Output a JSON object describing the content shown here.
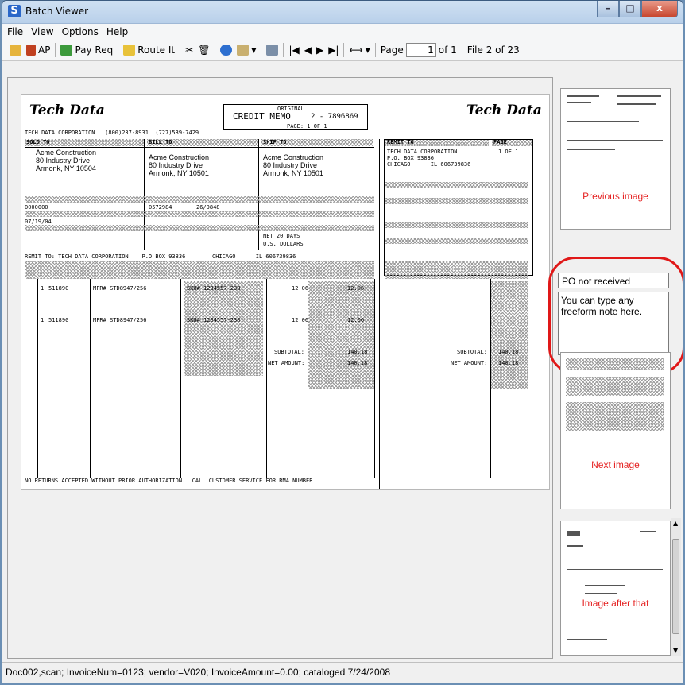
{
  "window": {
    "title": "Batch Viewer",
    "controls": {
      "minimize": "–",
      "maximize": "□",
      "close": "x"
    }
  },
  "menu": [
    "File",
    "View",
    "Options",
    "Help"
  ],
  "toolbar": {
    "ap_label": "AP",
    "payreq_label": "Pay Req",
    "routeit_label": "Route It",
    "page_label": "Page",
    "page_value": "1",
    "page_of": "of 1",
    "file_label": "File 2  of 23"
  },
  "document": {
    "logo": "Tech Data",
    "title_small": "ORIGINAL",
    "title": "CREDIT MEMO",
    "memo_no": "2 - 7896869",
    "page_info": "PAGE: 1 OF 1",
    "company_line": "TECH DATA CORPORATION   (800)237-8931  (727)539-7429",
    "sold_to_label": "SOLD TO",
    "sold_to": [
      "Acme Construction",
      "80 Industry Drive",
      "Armonk, NY 10504"
    ],
    "bill_to_label": "BILL TO",
    "bill_to": [
      "Acme Construction",
      "80 Industry Drive",
      "Armonk, NY 10501"
    ],
    "ship_to_label": "SHIP TO",
    "ship_to": [
      "Acme Construction",
      "80 Industry Drive",
      "Armonk, NY 10501"
    ],
    "remit_to_label": "REMIT TO",
    "remit_to": [
      "TECH DATA CORPORATION",
      "P.O. BOX 93836",
      "CHICAGO      IL 606739836"
    ],
    "page_box_label": "PAGE",
    "page_box_value": "1 OF 1",
    "row_values": [
      "0000000",
      "0572984",
      "26/0848",
      "07/19/04",
      "NET 20 DAYS",
      "U.S. DOLLARS"
    ],
    "remit_line": "REMIT TO: TECH DATA CORPORATION    P.O BOX 93836        CHICAGO      IL 606739836",
    "items": [
      {
        "qty": "1",
        "part": "511890",
        "desc": "MFR# STD8947/256",
        "sku": "SKU# 1234557-238",
        "price": "12.06",
        "ext": "12.06"
      },
      {
        "qty": "1",
        "part": "511890",
        "desc": "MFR# STD8947/256",
        "sku": "SKU# 1234557-238",
        "price": "12.06",
        "ext": "12.06"
      }
    ],
    "subtotal_label": "SUBTOTAL:",
    "net_label": "NET AMOUNT:",
    "subtotal_value": "140.18",
    "net_value": "140.18",
    "footer": "NO RETURNS ACCEPTED WITHOUT PRIOR AUTHORIZATION.  CALL CUSTOMER SERVICE FOR RMA NUMBER."
  },
  "thumbnails": {
    "previous_caption": "Previous image",
    "next_caption": "Next image",
    "after_caption": "Image after that"
  },
  "note": {
    "title_value": "PO not received",
    "body_value": "You can type any freeform note here."
  },
  "status": "Doc002,scan;  InvoiceNum=0123; vendor=V020; InvoiceAmount=0.00; cataloged 7/24/2008"
}
